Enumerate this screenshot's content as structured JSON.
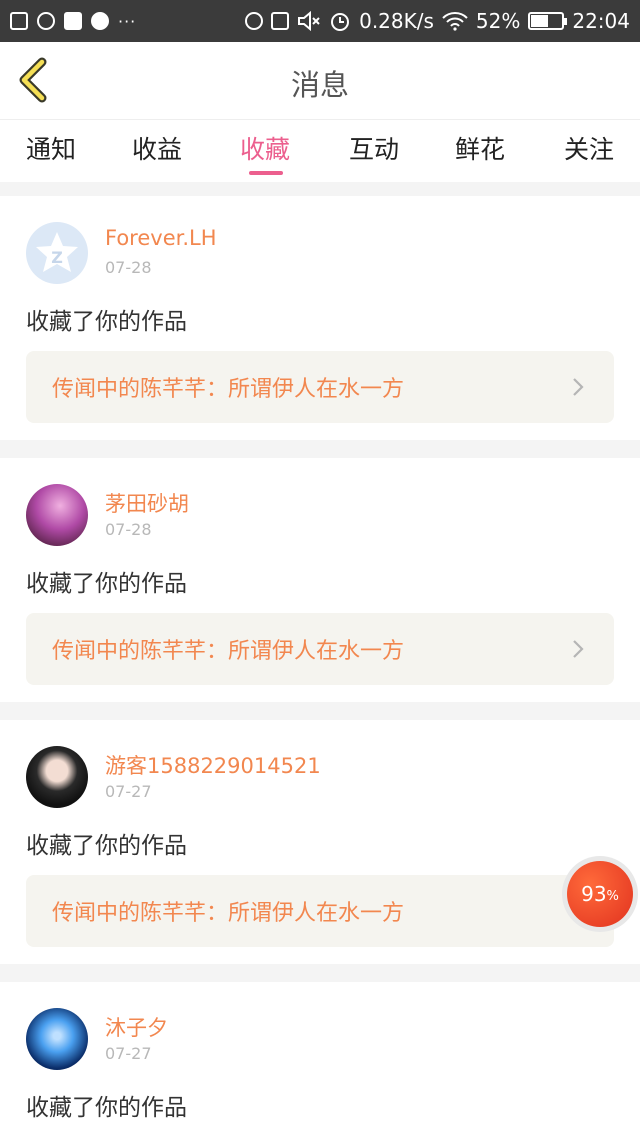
{
  "status_bar": {
    "dots": "···",
    "network_speed": "0.28K/s",
    "battery_percent": "52%",
    "battery_level": 0.52,
    "time": "22:04",
    "left_icons": [
      "image-icon",
      "chat-icon",
      "square-icon",
      "globe-icon"
    ],
    "right_icons": [
      "finger-icon",
      "sim-icon",
      "mute-icon",
      "alarm-icon",
      "wifi-icon",
      "battery-icon"
    ]
  },
  "header": {
    "title": "消息",
    "back_icon": "chevron-left-icon"
  },
  "tabs": [
    {
      "label": "通知"
    },
    {
      "label": "收益"
    },
    {
      "label": "收藏",
      "active": true
    },
    {
      "label": "互动"
    },
    {
      "label": "鲜花"
    },
    {
      "label": "关注"
    }
  ],
  "colors": {
    "accent": "#ec5f8e",
    "username": "#f2874f",
    "badge": "#e1321f"
  },
  "notifications": [
    {
      "username": "Forever.LH",
      "date": "07-28",
      "message": "收藏了你的作品",
      "work": "传闻中的陈芊芊：所谓伊人在水一方"
    },
    {
      "username": "茅田砂胡",
      "date": "07-28",
      "message": "收藏了你的作品",
      "work": "传闻中的陈芊芊：所谓伊人在水一方"
    },
    {
      "username": "游客1588229014521",
      "date": "07-27",
      "message": "收藏了你的作品",
      "work": "传闻中的陈芊芊：所谓伊人在水一方"
    },
    {
      "username": "沐子夕",
      "date": "07-27",
      "message": "收藏了你的作品"
    }
  ],
  "badge": {
    "value": "93",
    "unit": "%"
  }
}
